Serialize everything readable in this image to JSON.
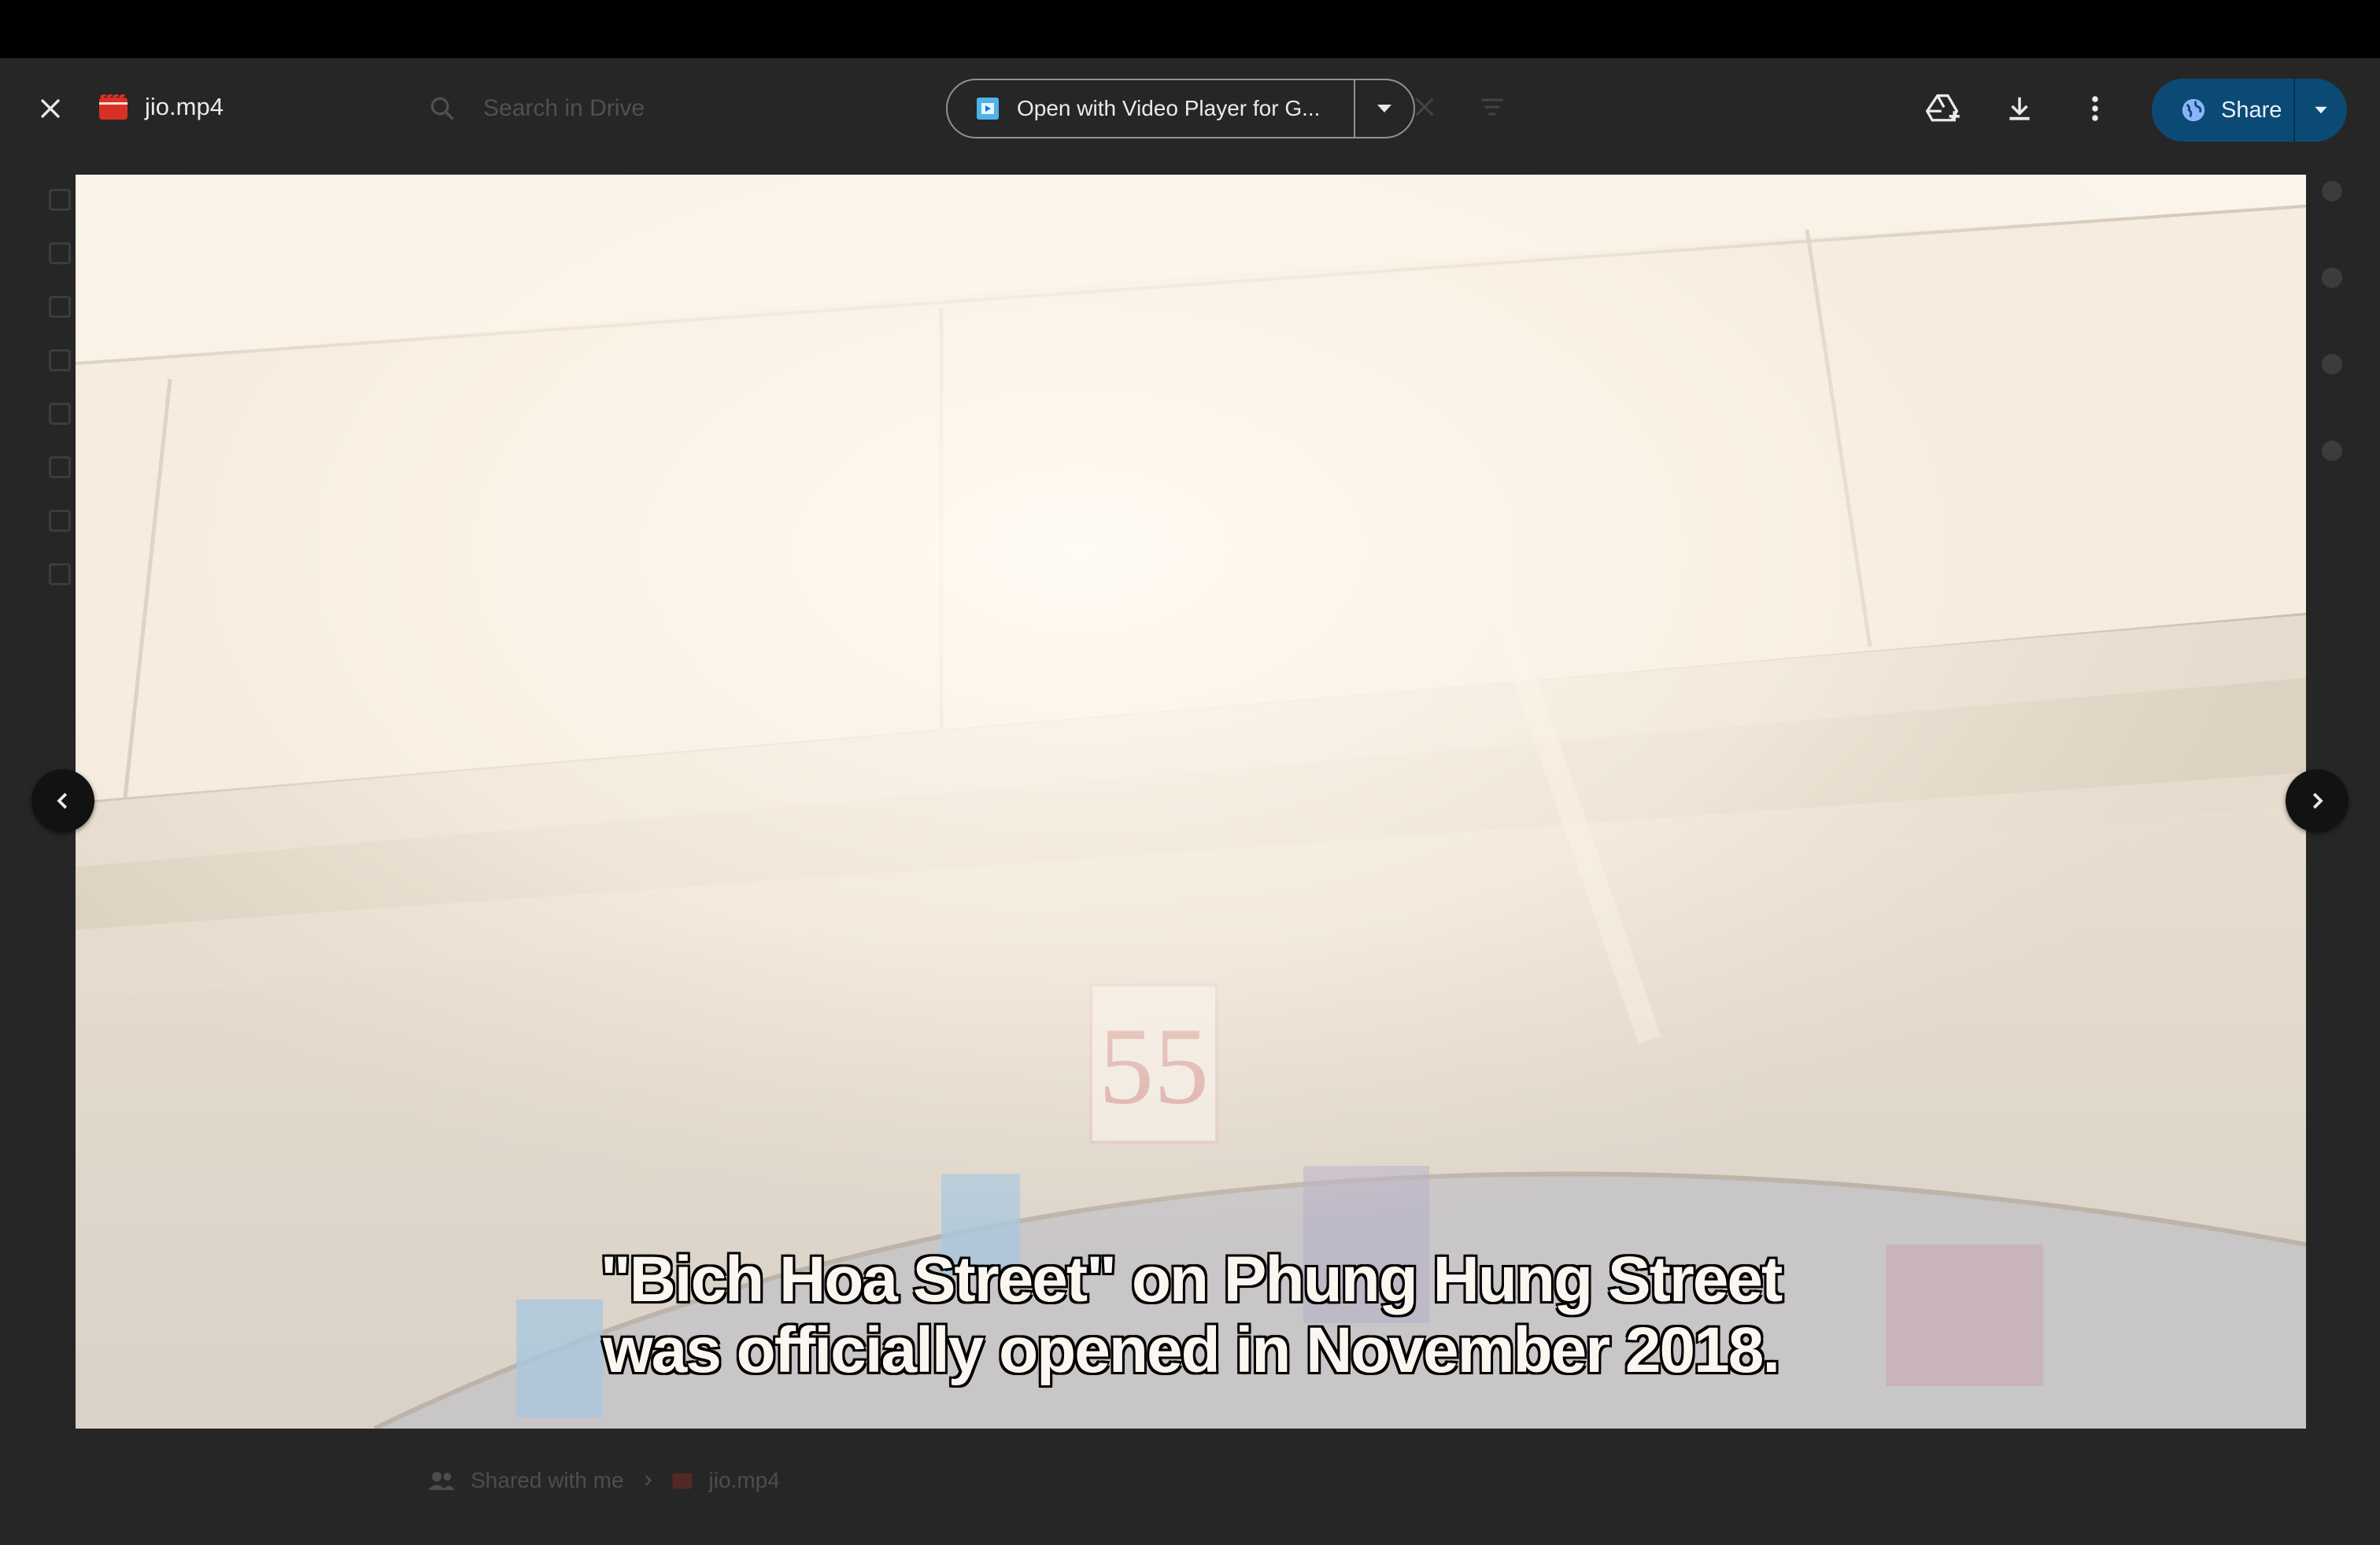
{
  "header": {
    "file_title": "jio.mp4",
    "search_placeholder": "Search in Drive",
    "open_with_label": "Open with Video Player for G...",
    "share_label": "Share"
  },
  "video": {
    "subtitle_lines": [
      "\"Bich Hoa Street\" on Phung Hung Street",
      "was officially opened in November 2018."
    ],
    "sign_number": "55"
  },
  "breadcrumb": {
    "items": [
      "Shared with me",
      "jio.mp4"
    ]
  },
  "icons": {
    "close": "close-icon",
    "file": "video-file-icon",
    "add_to_drive": "add-to-drive-icon",
    "download": "download-icon",
    "more": "more-vert-icon",
    "share_globe": "globe-icon",
    "prev": "chevron-left-icon",
    "next": "chevron-right-icon"
  },
  "colors": {
    "share_button": "#0b4a75",
    "file_icon_red": "#d93025",
    "background": "#262626"
  }
}
